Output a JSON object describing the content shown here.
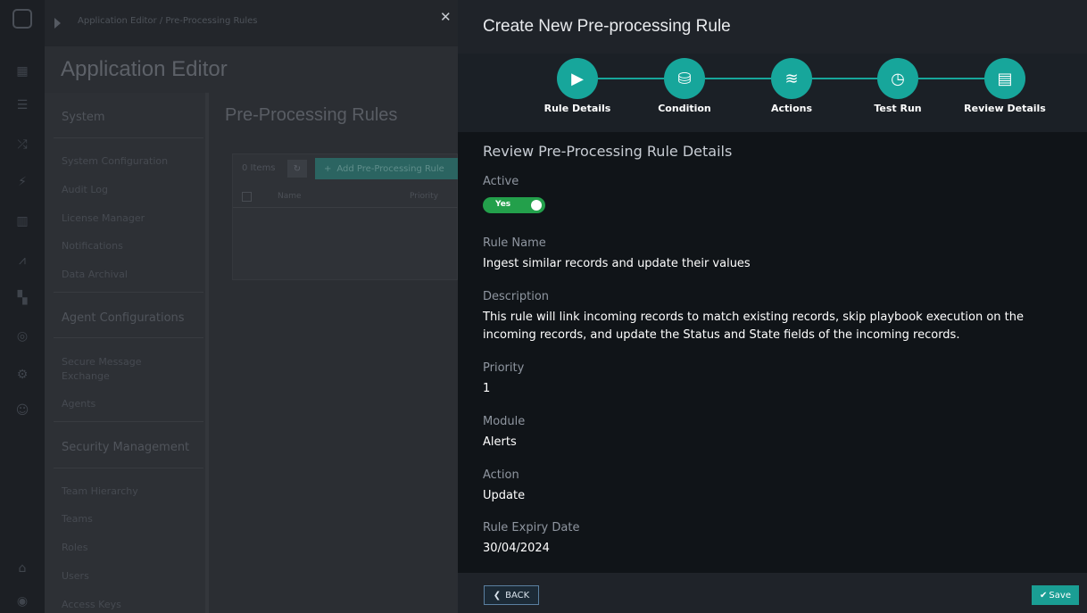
{
  "breadcrumb": {
    "parent": "Application Editor",
    "separator": "/",
    "current": "Pre-Processing Rules"
  },
  "app_title": "Application Editor",
  "settings_sidebar": {
    "sections": [
      {
        "heading": "System",
        "items": [
          "System Configuration",
          "Audit Log",
          "License Manager",
          "Notifications",
          "Data Archival"
        ]
      },
      {
        "heading": "Agent Configurations",
        "items": [
          "Secure Message Exchange",
          "Agents"
        ]
      },
      {
        "heading": "Security Management",
        "items": [
          "Team Hierarchy",
          "Teams",
          "Roles",
          "Users",
          "Access Keys"
        ]
      }
    ]
  },
  "background_page": {
    "heading": "Pre-Processing Rules",
    "item_count": "0 Items",
    "add_button": "Add Pre-Processing Rule",
    "columns": [
      "Name",
      "Priority"
    ]
  },
  "drawer": {
    "title": "Create New Pre-processing Rule",
    "steps": [
      {
        "label": "Rule Details",
        "icon": "play-icon"
      },
      {
        "label": "Condition",
        "icon": "database-icon"
      },
      {
        "label": "Actions",
        "icon": "sliders-icon"
      },
      {
        "label": "Test Run",
        "icon": "calendar-clock-icon"
      },
      {
        "label": "Review Details",
        "icon": "document-icon"
      }
    ],
    "review_title": "Review Pre-Processing Rule Details",
    "fields": {
      "active_label": "Active",
      "active_value": "Yes",
      "rule_name_label": "Rule Name",
      "rule_name_value": "Ingest similar records and update their values",
      "description_label": "Description",
      "description_value": "This rule will link incoming records to match existing records, skip playbook execution on the incoming records, and update the Status and State fields of the incoming records.",
      "priority_label": "Priority",
      "priority_value": "1",
      "module_label": "Module",
      "module_value": "Alerts",
      "action_label": "Action",
      "action_value": "Update",
      "expiry_label": "Rule Expiry Date",
      "expiry_value": "30/04/2024"
    },
    "footer": {
      "back_label": "BACK",
      "save_label": "Save"
    }
  },
  "colors": {
    "accent": "#17a69b",
    "toggle_on": "#23a04b",
    "drawer_bg": "#101418"
  }
}
